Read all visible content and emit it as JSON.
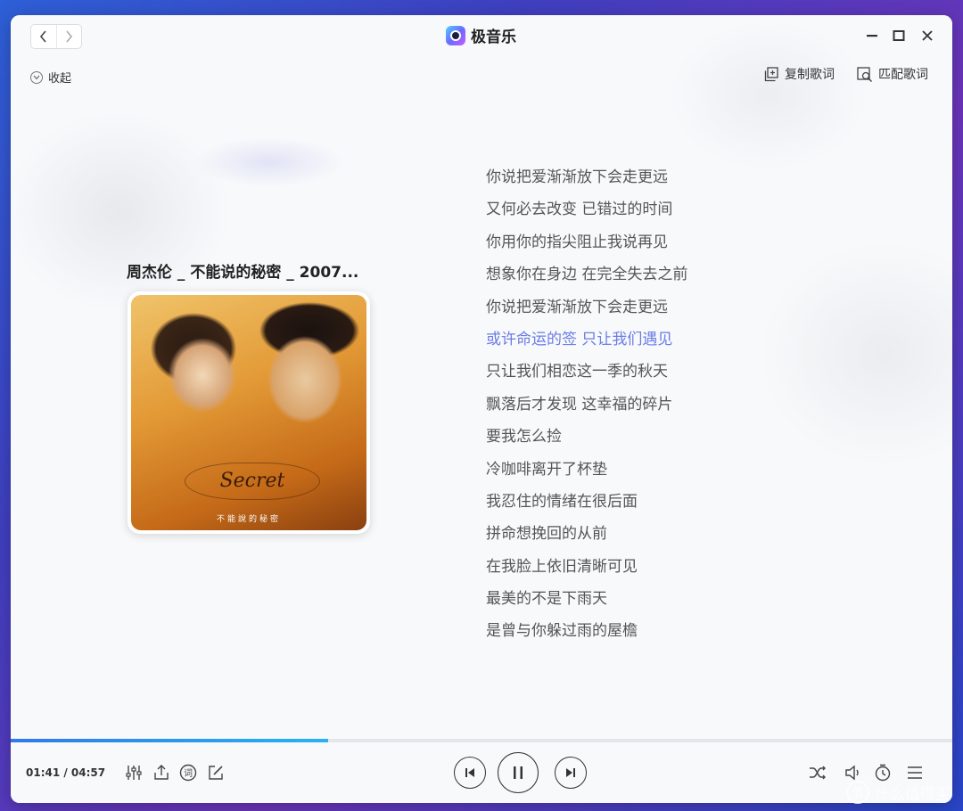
{
  "app": {
    "title": "极音乐"
  },
  "panel": {
    "collapse_label": "收起",
    "copy_lyrics_label": "复制歌词",
    "match_lyrics_label": "匹配歌词"
  },
  "song": {
    "title": "周杰伦 _ 不能说的秘密 _ 2007...",
    "cover_logo": "Secret",
    "cover_subtitle": "不能說的秘密"
  },
  "lyrics": {
    "lines": [
      "你说把爱渐渐放下会走更远",
      "又何必去改变 已错过的时间",
      "你用你的指尖阻止我说再见",
      "想象你在身边 在完全失去之前",
      "你说把爱渐渐放下会走更远",
      "或许命运的签 只让我们遇见",
      "只让我们相恋这一季的秋天",
      "飘落后才发现 这幸福的碎片",
      "要我怎么捡",
      "冷咖啡离开了杯垫",
      "我忍住的情绪在很后面",
      "拼命想挽回的从前",
      "在我脸上依旧清晰可见",
      "最美的不是下雨天",
      "是曾与你躲过雨的屋檐"
    ],
    "active_index": 5
  },
  "player": {
    "time_display": "01:41 / 04:57",
    "progress_fraction": 0.337
  },
  "watermark": {
    "text": "什么值得买",
    "icon_text": "值"
  },
  "colors": {
    "accent": "#6a7ce6",
    "progress": "#2f8ef0"
  },
  "icons": {
    "back": "chevron-left-icon",
    "forward": "chevron-right-icon",
    "minimize": "minimize-icon",
    "maximize": "maximize-icon",
    "close": "close-icon",
    "collapse": "chevron-down-circle-icon",
    "copy": "copy-icon",
    "match": "search-lyrics-icon",
    "equalizer": "equalizer-icon",
    "share": "share-icon",
    "lyrics_toggle": "lyrics-icon",
    "edit": "edit-icon",
    "prev": "previous-icon",
    "pause": "pause-icon",
    "next": "next-icon",
    "shuffle": "shuffle-icon",
    "volume": "volume-icon",
    "timer": "timer-icon",
    "playlist": "playlist-icon"
  }
}
